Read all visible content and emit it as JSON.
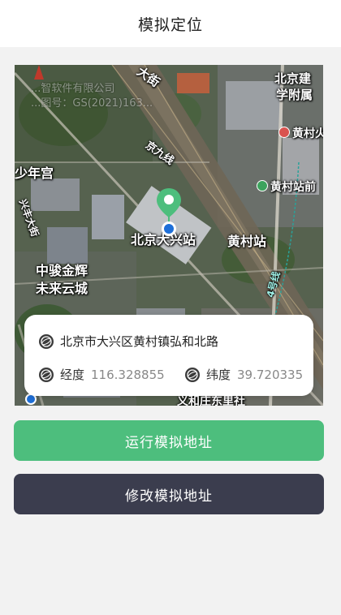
{
  "header": {
    "title": "模拟定位"
  },
  "map": {
    "watermark_line1": "...智软件有限公司",
    "watermark_line2": "...图号：GS(2021)163...",
    "labels": {
      "street_top": "大街",
      "poi_beijing_jianzhu": "北京建",
      "poi_xuefu": "学附属",
      "poi_huangcun_huo": "黄村火",
      "poi_huangcun_station": "黄村站前",
      "rail_jingjiu": "京九线",
      "area_shaonian": "少年宫",
      "area_huangcun": "黄村站",
      "road_xingfeng": "兴丰大街",
      "main_station": "北京大兴站",
      "area_zhongjun": "中骏金辉",
      "area_weilai": "未来云城",
      "metro_line4": "4号线",
      "bottom_road": "义和庄东里社"
    }
  },
  "location": {
    "address": "北京市大兴区黄村镇弘和北路",
    "longitude_label": "经度",
    "longitude_value": "116.328855",
    "latitude_label": "纬度",
    "latitude_value": "39.720335"
  },
  "actions": {
    "run_label": "运行模拟地址",
    "edit_label": "修改模拟地址"
  },
  "colors": {
    "accent_green": "#4dbe7d",
    "dark_button": "#3b3d4e",
    "pin_green": "#4dbe7d",
    "dot_blue": "#1e6fd8"
  },
  "icons": {
    "address_icon": "globe-icon",
    "longitude_icon": "globe-icon",
    "latitude_icon": "globe-icon",
    "map_pin": "location-pin-icon",
    "current_dot": "current-location-dot-icon"
  }
}
